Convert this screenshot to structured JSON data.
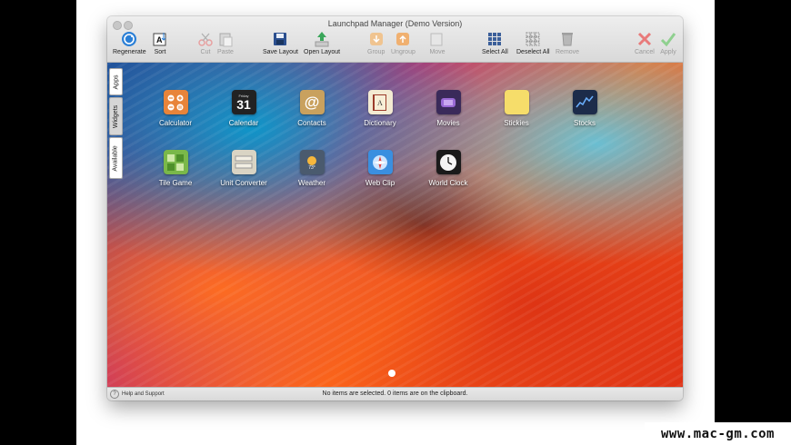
{
  "window": {
    "title": "Launchpad Manager (Demo Version)"
  },
  "toolbar": {
    "regenerate": "Regenerate",
    "sort": "Sort",
    "cut": "Cut",
    "paste": "Paste",
    "save_layout": "Save Layout",
    "open_layout": "Open Layout",
    "group": "Group",
    "ungroup": "Ungroup",
    "move": "Move",
    "select_all": "Select All",
    "deselect_all": "Deselect All",
    "remove": "Remove",
    "cancel": "Cancel",
    "apply": "Apply"
  },
  "side_tabs": [
    "Apps",
    "Widgets",
    "Available"
  ],
  "apps": [
    {
      "name": "Calculator"
    },
    {
      "name": "Calendar",
      "icon_day": "Friday",
      "icon_date": "31"
    },
    {
      "name": "Contacts",
      "icon_glyph": "@"
    },
    {
      "name": "Dictionary"
    },
    {
      "name": "Movies"
    },
    {
      "name": "Stickies"
    },
    {
      "name": "Stocks"
    },
    {
      "name": "Tile Game"
    },
    {
      "name": "Unit Converter"
    },
    {
      "name": "Weather",
      "icon_temp": "73°"
    },
    {
      "name": "Web Clip"
    },
    {
      "name": "World Clock"
    }
  ],
  "status": {
    "help": "Help and Support",
    "text": "No items are selected. 0 items are on the clipboard."
  },
  "watermark": "www.mac-gm.com"
}
